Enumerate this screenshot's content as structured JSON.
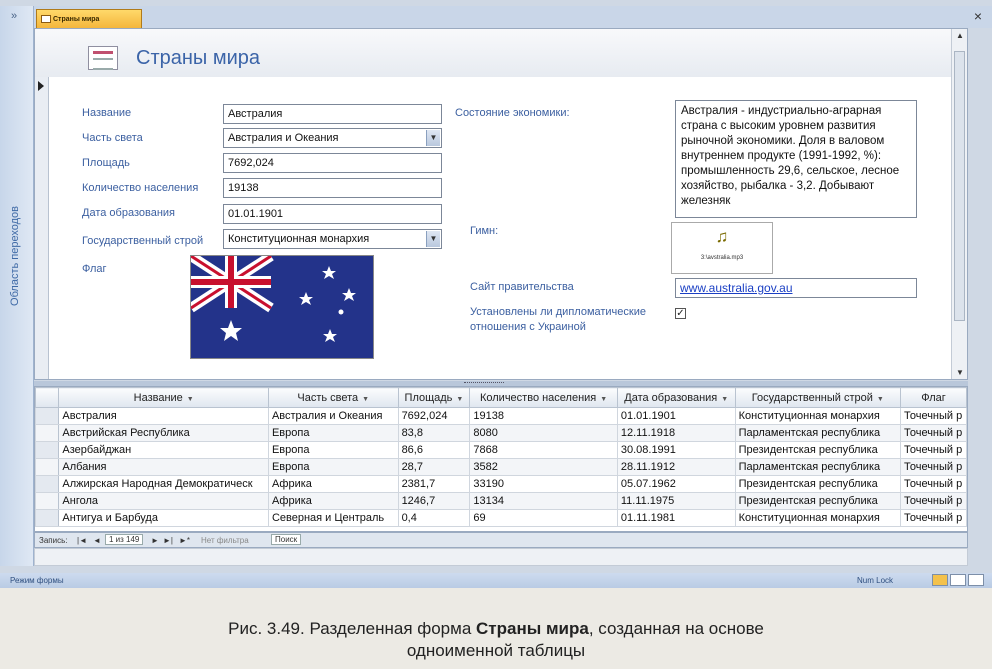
{
  "window": {
    "nav_pane_label": "Область переходов",
    "nav_pane_toggle": "»",
    "tab_label": "Страны мира",
    "close_symbol": "×"
  },
  "form": {
    "title": "Страны мира",
    "labels": {
      "name": "Название",
      "continent": "Часть света",
      "area": "Площадь",
      "population": "Количество населения",
      "founded": "Дата образования",
      "government": "Государственный строй",
      "flag": "Флаг",
      "economy": "Состояние экономики:",
      "anthem": "Гимн:",
      "website": "Сайт правительства",
      "diplomatic": "Установлены ли дипломатические отношения с Украиной"
    },
    "values": {
      "name": "Австралия",
      "continent": "Австралия и Океания",
      "area": "7692,024",
      "population": "19138",
      "founded": "01.01.1901",
      "government": "Конституционная монархия",
      "economy": "Австралия - индустриально-аграрная страна с высоким уровнем развития рыночной экономики. Доля в валовом внутреннем продукте (1991-1992, %): промышленность 29,6, сельское, лесное хозяйство, рыбалка - 3,2. Добывают железняк",
      "anthem_file": "3:\\avstralia.mp3",
      "website": "www.australia.gov.au",
      "diplomatic": true
    }
  },
  "datasheet": {
    "columns": [
      "Название",
      "Часть света",
      "Площадь",
      "Количество населения",
      "Дата образования",
      "Государственный строй",
      "Флаг"
    ],
    "rows": [
      [
        "Австралия",
        "Австралия и Океания",
        "7692,024",
        "19138",
        "01.01.1901",
        "Конституционная монархия",
        "Точечный р"
      ],
      [
        "Австрийская Республика",
        "Европа",
        "83,8",
        "8080",
        "12.11.1918",
        "Парламентская республика",
        "Точечный р"
      ],
      [
        "Азербайджан",
        "Европа",
        "86,6",
        "7868",
        "30.08.1991",
        "Президентская республика",
        "Точечный р"
      ],
      [
        "Албания",
        "Европа",
        "28,7",
        "3582",
        "28.11.1912",
        "Парламентская республика",
        "Точечный р"
      ],
      [
        "Алжирская Народная Демократическ",
        "Африка",
        "2381,7",
        "33190",
        "05.07.1962",
        "Президентская республика",
        "Точечный р"
      ],
      [
        "Ангола",
        "Африка",
        "1246,7",
        "13134",
        "11.11.1975",
        "Президентская республика",
        "Точечный р"
      ],
      [
        "Антигуа и Барбуда",
        "Северная и Централь",
        "0,4",
        "69",
        "01.11.1981",
        "Конституционная монархия",
        "Точечный р"
      ]
    ]
  },
  "record_nav": {
    "label": "Запись:",
    "position": "1 из 149",
    "filter": "Нет фильтра",
    "search": "Поиск"
  },
  "statusbar": {
    "mode": "Режим формы",
    "numlock": "Num Lock"
  },
  "caption": {
    "prefix": "Рис. 3.49. Разделенная форма ",
    "bold": "Страны мира",
    "suffix": ", созданная на основе",
    "line2": "одноименной таблицы"
  },
  "colors": {
    "label_blue": "#3b5fa0",
    "title_blue": "#3b64a8",
    "tab_orange": "#f4b63c",
    "link_blue": "#1a3fc4"
  }
}
